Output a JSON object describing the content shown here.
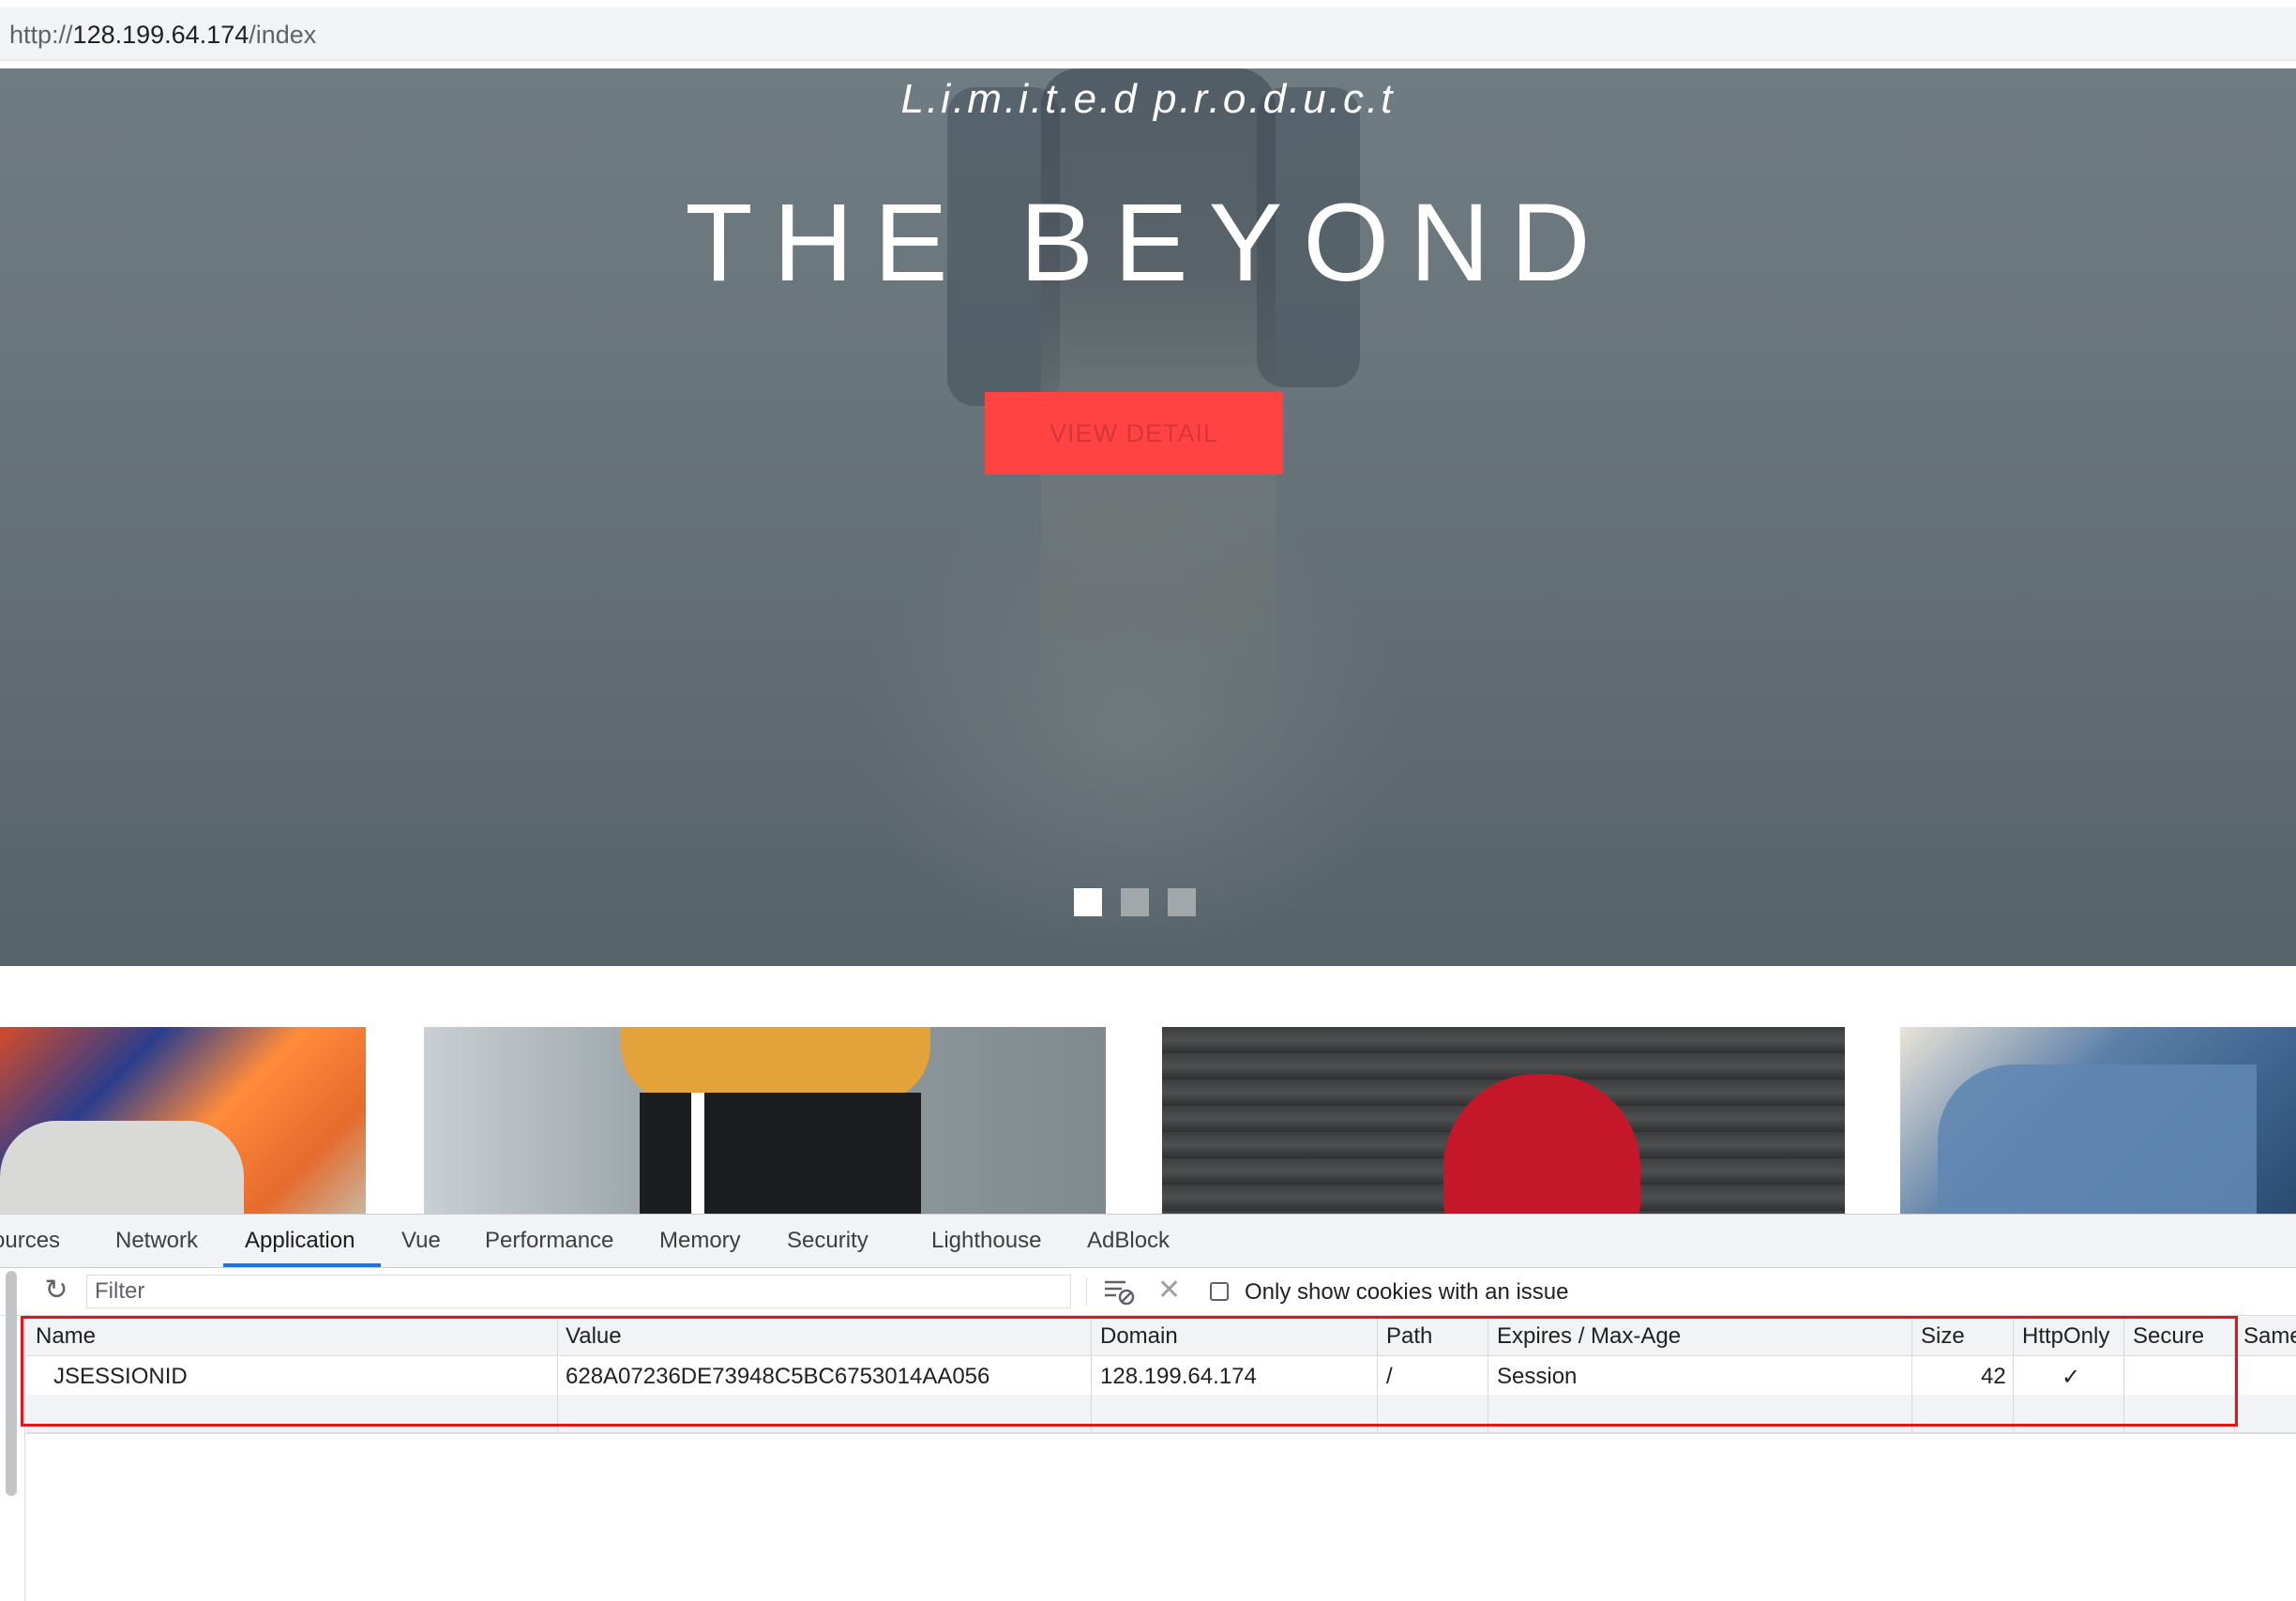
{
  "address_bar": {
    "scheme": "http://",
    "host": "128.199.64.174",
    "path": "/index"
  },
  "hero": {
    "tagline": "L.i.m.i.t.e.d p.r.o.d.u.c.t",
    "title": "THE BEYOND",
    "button_label": "VIEW DETAIL",
    "slides_count": 3,
    "active_slide": 1
  },
  "thumbnails": [
    "graffiti-tee",
    "yellow-hoodie-trackpants",
    "red-cap-wood",
    "denim-jeans"
  ],
  "devtools": {
    "tabs": [
      {
        "label": "ources"
      },
      {
        "label": "Network"
      },
      {
        "label": "Application"
      },
      {
        "label": "Vue"
      },
      {
        "label": "Performance"
      },
      {
        "label": "Memory"
      },
      {
        "label": "Security"
      },
      {
        "label": "Lighthouse"
      },
      {
        "label": "AdBlock"
      }
    ],
    "active_tab": "Application",
    "filter_placeholder": "Filter",
    "only_issues_label": "Only show cookies with an issue",
    "columns": [
      "Name",
      "Value",
      "Domain",
      "Path",
      "Expires / Max-Age",
      "Size",
      "HttpOnly",
      "Secure",
      "Same"
    ],
    "rows": [
      {
        "name": "JSESSIONID",
        "value": "628A07236DE73948C5BC6753014AA056",
        "domain": "128.199.64.174",
        "path": "/",
        "expires": "Session",
        "size": "42",
        "httponly": "✓",
        "secure": "",
        "samesite": ""
      }
    ],
    "colors": {
      "highlight": "#e3141b",
      "accent_tab": "#1a73e8",
      "hero_button": "#ff4242"
    }
  }
}
